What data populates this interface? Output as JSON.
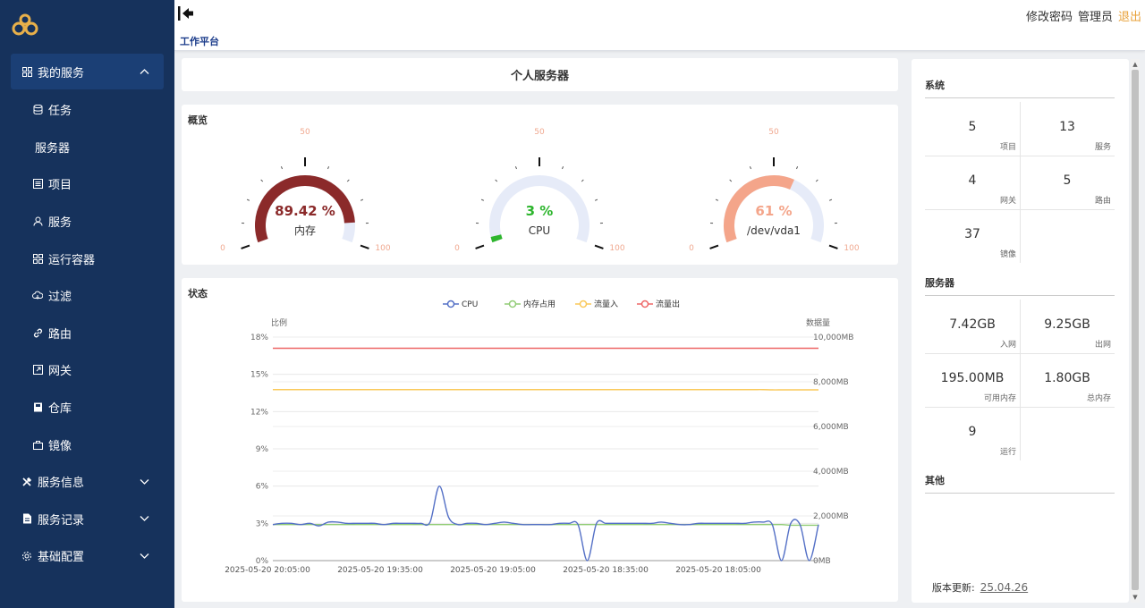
{
  "sidebar": {
    "items": [
      {
        "label": "我的服务",
        "icon": "grid-icon",
        "type": "group",
        "expanded": true
      },
      {
        "label": "任务",
        "icon": "database-icon",
        "type": "sub"
      },
      {
        "label": "服务器",
        "icon": "",
        "type": "sub"
      },
      {
        "label": "项目",
        "icon": "list-icon",
        "type": "sub"
      },
      {
        "label": "服务",
        "icon": "user-icon",
        "type": "sub"
      },
      {
        "label": "运行容器",
        "icon": "grid-icon",
        "type": "sub"
      },
      {
        "label": "过滤",
        "icon": "cloud-icon",
        "type": "sub"
      },
      {
        "label": "路由",
        "icon": "link-icon",
        "type": "sub"
      },
      {
        "label": "网关",
        "icon": "export-icon",
        "type": "sub"
      },
      {
        "label": "仓库",
        "icon": "book-icon",
        "type": "sub"
      },
      {
        "label": "镜像",
        "icon": "bag-icon",
        "type": "sub"
      },
      {
        "label": "服务信息",
        "icon": "tools-icon",
        "type": "group",
        "expanded": false
      },
      {
        "label": "服务记录",
        "icon": "document-icon",
        "type": "group",
        "expanded": false
      },
      {
        "label": "基础配置",
        "icon": "gear-icon",
        "type": "group",
        "expanded": false
      }
    ]
  },
  "header": {
    "breadcrumb": "工作平台",
    "change_password": "修改密码",
    "admin": "管理员",
    "logout": "退出"
  },
  "main": {
    "title": "个人服务器",
    "overview_label": "概览",
    "status_label": "状态"
  },
  "gauges": [
    {
      "value_text": "89.42 %",
      "label": "内存",
      "percent": 89.42,
      "color": "#8b2a2a",
      "min": "0",
      "mid": "50",
      "max": "100"
    },
    {
      "value_text": "3 %",
      "label": "CPU",
      "percent": 3,
      "color": "#2db52d",
      "min": "0",
      "mid": "50",
      "max": "100"
    },
    {
      "value_text": "61 %",
      "label": "/dev/vda1",
      "percent": 61,
      "color": "#f4a58a",
      "min": "0",
      "mid": "50",
      "max": "100"
    }
  ],
  "chart_data": {
    "type": "line",
    "legend": [
      "CPU",
      "内存占用",
      "流量入",
      "流量出"
    ],
    "legend_colors": [
      "#5470c6",
      "#91cc75",
      "#fac858",
      "#ee6666"
    ],
    "ylabel_left": "比例",
    "ylabel_right": "数据量",
    "y_left_ticks": [
      "18%",
      "15%",
      "12%",
      "9%",
      "6%",
      "3%",
      "0%"
    ],
    "y_right_ticks": [
      "10,000MB",
      "8,000MB",
      "6,000MB",
      "4,000MB",
      "2,000MB",
      "0MB"
    ],
    "x_ticks": [
      "2025-05-20 20:05:00",
      "2025-05-20 19:35:00",
      "2025-05-20 19:05:00",
      "2025-05-20 18:35:00",
      "2025-05-20 18:05:00"
    ],
    "ylim_left": [
      0,
      18
    ],
    "ylim_right": [
      0,
      10000
    ],
    "series": [
      {
        "name": "CPU",
        "axis": "left",
        "values": [
          2.9,
          3.0,
          3.0,
          2.9,
          3.0,
          2.8,
          3.1,
          3.1,
          3.0,
          3.0,
          3.0,
          3.0,
          2.9,
          3.0,
          3.0,
          3.0,
          3.0,
          3.1,
          6.0,
          3.5,
          2.9,
          3.0,
          3.0,
          2.9,
          3.0,
          3.1,
          3.0,
          2.9,
          2.9,
          2.9,
          2.9,
          3.0,
          3.0,
          2.9,
          0.0,
          3.0,
          3.0,
          3.0,
          3.0,
          3.0,
          3.0,
          3.0,
          3.1,
          3.0,
          2.9,
          2.9,
          3.0,
          3.0,
          3.0,
          3.0,
          3.0,
          3.0,
          3.1,
          3.1,
          2.9,
          0.0,
          3.0,
          2.9,
          0.0,
          2.9
        ]
      },
      {
        "name": "内存占用",
        "axis": "left",
        "values": [
          2.9,
          2.9,
          2.9,
          2.9,
          2.9,
          2.9,
          2.9,
          2.9,
          2.9,
          2.9,
          2.9,
          2.9,
          2.9,
          2.9,
          2.9,
          2.9,
          2.9,
          2.9,
          2.9,
          2.9,
          2.9,
          2.9,
          2.9,
          2.9,
          2.9,
          2.9,
          2.9,
          2.9,
          2.9,
          2.9,
          2.9,
          2.9,
          2.9,
          2.9,
          2.9,
          2.9,
          2.9,
          2.9,
          2.9,
          2.9,
          2.9,
          2.9,
          2.9,
          2.9,
          2.9,
          2.9,
          2.9,
          2.9,
          2.9,
          2.9,
          2.9,
          2.9,
          2.9,
          2.9,
          2.9,
          2.9,
          2.85,
          2.85,
          2.85,
          2.85
        ]
      },
      {
        "name": "流量入",
        "axis": "right",
        "values": [
          7650,
          7650,
          7650,
          7650,
          7650,
          7650,
          7650,
          7650,
          7650,
          7650,
          7650,
          7650,
          7650,
          7650,
          7650,
          7650,
          7650,
          7650,
          7650,
          7650,
          7650,
          7650,
          7650,
          7650,
          7650,
          7650,
          7650,
          7650,
          7650,
          7650,
          7650,
          7650,
          7650,
          7650,
          7650,
          7650,
          7650,
          7650,
          7650,
          7650,
          7650,
          7650,
          7650,
          7650,
          7650,
          7650,
          7650,
          7650,
          7650,
          7650,
          7650,
          7650,
          7650,
          7650,
          7640,
          7640,
          7640,
          7640,
          7640,
          7640
        ]
      },
      {
        "name": "流量出",
        "axis": "right",
        "values": [
          9500,
          9500,
          9500,
          9500,
          9500,
          9500,
          9500,
          9500,
          9500,
          9500,
          9500,
          9500,
          9500,
          9500,
          9500,
          9500,
          9500,
          9500,
          9500,
          9500,
          9500,
          9500,
          9500,
          9500,
          9500,
          9500,
          9500,
          9500,
          9500,
          9500,
          9500,
          9500,
          9500,
          9500,
          9500,
          9500,
          9500,
          9500,
          9500,
          9500,
          9500,
          9500,
          9500,
          9500,
          9500,
          9500,
          9500,
          9500,
          9500,
          9500,
          9500,
          9500,
          9500,
          9500,
          9500,
          9500,
          9500,
          9500,
          9500,
          9500
        ]
      }
    ]
  },
  "right": {
    "system_title": "系统",
    "system_stats": [
      {
        "value": "5",
        "label": "项目"
      },
      {
        "value": "13",
        "label": "服务"
      },
      {
        "value": "4",
        "label": "网关"
      },
      {
        "value": "5",
        "label": "路由"
      },
      {
        "value": "37",
        "label": "镜像"
      }
    ],
    "server_title": "服务器",
    "server_stats": [
      {
        "value": "7.42GB",
        "label": "入网"
      },
      {
        "value": "9.25GB",
        "label": "出网"
      },
      {
        "value": "195.00MB",
        "label": "可用内存"
      },
      {
        "value": "1.80GB",
        "label": "总内存"
      },
      {
        "value": "9",
        "label": "运行"
      }
    ],
    "other_title": "其他",
    "version_label": "版本更新:",
    "version_value": "25.04.26"
  }
}
